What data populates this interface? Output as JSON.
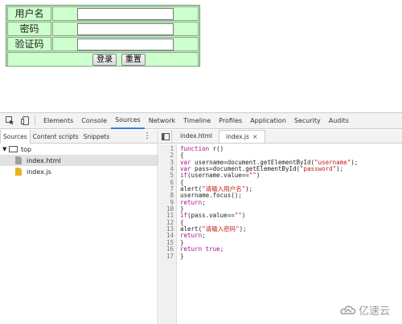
{
  "form": {
    "rows": [
      {
        "label": "用户名"
      },
      {
        "label": "密码"
      },
      {
        "label": "验证码"
      }
    ],
    "login_label": "登录",
    "reset_label": "重置"
  },
  "devtools": {
    "tabs": [
      "Elements",
      "Console",
      "Sources",
      "Network",
      "Timeline",
      "Profiles",
      "Application",
      "Security",
      "Audits"
    ],
    "active_tab": "Sources",
    "navigator_tabs": [
      "Sources",
      "Content scripts",
      "Snippets"
    ],
    "tree": {
      "root": "top",
      "files": [
        "index.html",
        "index.js"
      ],
      "selected": "index.html"
    },
    "editor_tabs": [
      "index.html",
      "index.js"
    ],
    "active_editor_tab": "index.js",
    "line_numbers": [
      "1",
      "2",
      "3",
      "4",
      "5",
      "6",
      "7",
      "8",
      "9",
      "10",
      "11",
      "12",
      "13",
      "14",
      "15",
      "16",
      "17"
    ]
  },
  "code_lines": [
    "function r()",
    "{",
    "var username=document.getElementById(\"username\");",
    "var pass=document.getElementById(\"password\");",
    "if(username.value==\"\")",
    "{",
    "alert(\"请输入用户名\");",
    "username.focus();",
    "return;",
    "}",
    "if(pass.value==\"\")",
    "{",
    "alert(\"请输入密码\");",
    "return;",
    "}",
    "return true;",
    "}"
  ],
  "watermark": "亿速云",
  "colors": {
    "form_bg": "#ccffcc",
    "active_tab_underline": "#3879d9",
    "keyword": "#aa0d91",
    "string": "#c41a16",
    "folder_icon": "#e8b424"
  }
}
